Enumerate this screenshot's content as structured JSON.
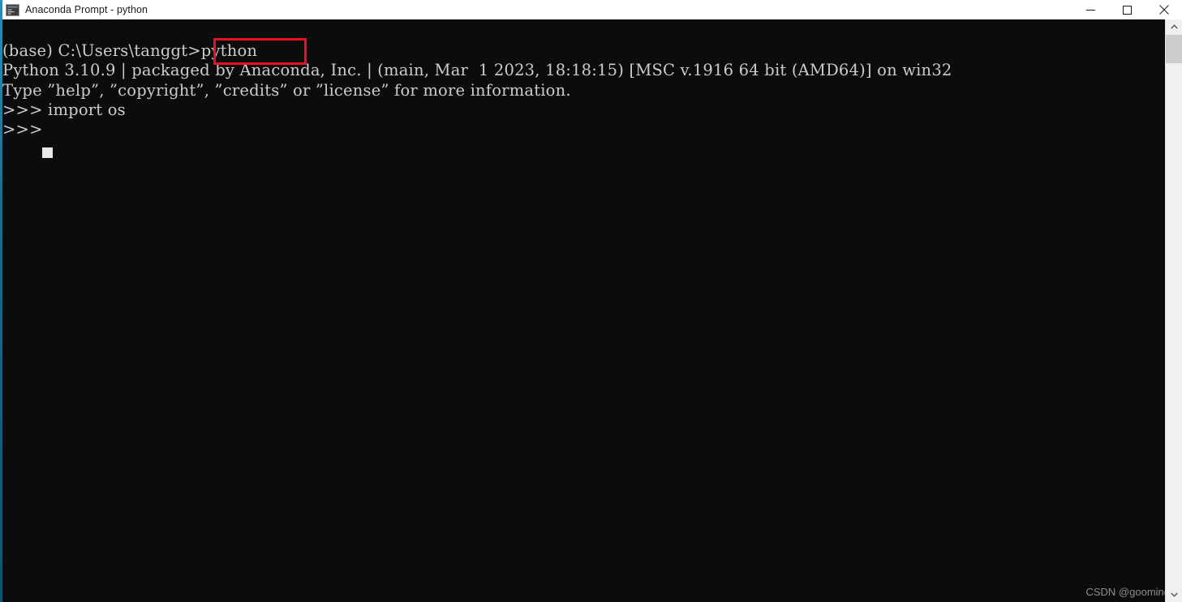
{
  "window": {
    "title": "Anaconda Prompt - python",
    "icon": "console-icon",
    "background_color": "#0c0c0c",
    "titlebar_color": "#ffffff",
    "accent_border_color": "#1b6c8c"
  },
  "window_controls": {
    "minimize_label": "Minimize",
    "maximize_label": "Maximize",
    "close_label": "Close"
  },
  "terminal": {
    "foreground_color": "#cccccc",
    "lines": [
      "(base) C:\\Users\\tanggt>python",
      "Python 3.10.9 | packaged by Anaconda, Inc. | (main, Mar  1 2023, 18:18:15) [MSC v.1916 64 bit (AMD64)] on win32",
      "Type ”help”, ”copyright”, ”credits” or ”license” for more information.",
      ">>> import os",
      ">>> "
    ],
    "prompt_line_1": "(base) C:\\Users\\tanggt>python",
    "version_line": "Python 3.10.9 | packaged by Anaconda, Inc. | (main, Mar  1 2023, 18:18:15) [MSC v.1916 64 bit (AMD64)] on win32",
    "help_line": "Type ”help”, ”copyright”, ”credits” or ”license” for more information.",
    "import_line": ">>> import os",
    "last_prompt": ">>> ",
    "cursor": "block-cursor"
  },
  "annotation": {
    "highlight_color": "#e81123",
    "highlighted_text": ">python"
  },
  "watermark": {
    "text": "CSDN @goomind"
  },
  "scrollbar": {
    "up_arrow": "chevron-up-icon",
    "down_arrow": "chevron-down-icon",
    "thumb": "scrollbar-thumb"
  }
}
